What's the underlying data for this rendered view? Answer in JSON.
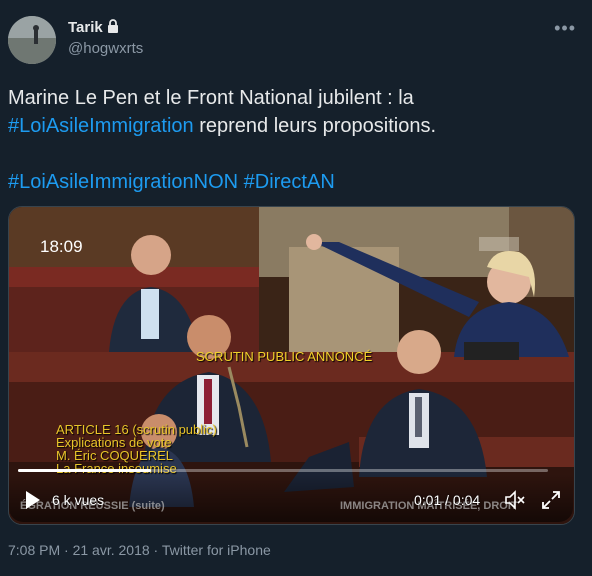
{
  "author": {
    "name": "Tarik",
    "handle": "@hogwxrts"
  },
  "tweet": {
    "line1_text": "Marine Le Pen et le Front National jubilent : la",
    "line2_hashtag": "#LoiAsileImmigration",
    "line2_text": " reprend leurs propositions.",
    "hashtag_2": "#LoiAsileImmigrationNON",
    "hashtag_3": "#DirectAN"
  },
  "video": {
    "clock": "18:09",
    "overlay_title": "SCRUTIN PUBLIC ANNONCÉ",
    "overlay_lines": [
      "ARTICLE 16 (scrutin public)",
      "Explications de vote",
      "M. Éric COQUEREL",
      "La France insoumise"
    ],
    "ticker_left": "ÉGRATION RÉUSSIE (suite)",
    "ticker_right": "IMMIGRATION MAÎTRISÉE, DROIT",
    "views": "6 k vues",
    "time": "0:01 / 0:04",
    "progress": 0.25,
    "play_icon": "play-icon",
    "volume_icon": "volume-icon",
    "fullscreen_icon": "fullscreen-icon"
  },
  "meta": "7:08 PM · 21 avr. 2018 · Twitter for iPhone",
  "colors": {
    "background": "#15202b",
    "hashtag": "#1d9bf0",
    "secondary_text": "#8b98a5"
  }
}
